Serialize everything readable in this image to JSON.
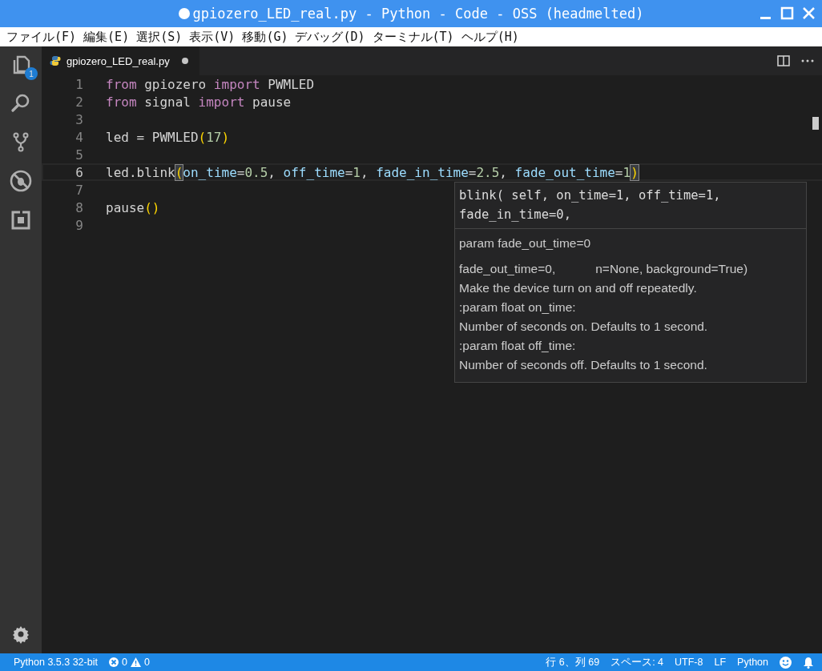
{
  "window": {
    "title": "gpiozero_LED_real.py - Python - Code - OSS (headmelted)",
    "dirty": true
  },
  "menu": [
    "ファイル(F)",
    "編集(E)",
    "選択(S)",
    "表示(V)",
    "移動(G)",
    "デバッグ(D)",
    "ターミナル(T)",
    "ヘルプ(H)"
  ],
  "activity_bar": {
    "items": [
      {
        "kind": "files",
        "selected": false,
        "badge": "1"
      },
      {
        "kind": "search",
        "selected": false
      },
      {
        "kind": "git",
        "selected": false
      },
      {
        "kind": "debug",
        "selected": false
      },
      {
        "kind": "extensions",
        "selected": false
      }
    ]
  },
  "tabs": [
    {
      "label": "gpiozero_LED_real.py",
      "selected": true,
      "dirty": true
    }
  ],
  "editor": {
    "lines": [
      {
        "number": "1",
        "current": false,
        "tokens": [
          {
            "text": "from",
            "kind": "keyword"
          },
          {
            "text": " gpiozero ",
            "kind": "plain"
          },
          {
            "text": "import",
            "kind": "keyword"
          },
          {
            "text": " PWMLED",
            "kind": "plain"
          }
        ]
      },
      {
        "number": "2",
        "current": false,
        "tokens": [
          {
            "text": "from",
            "kind": "keyword"
          },
          {
            "text": " signal ",
            "kind": "plain"
          },
          {
            "text": "import",
            "kind": "keyword"
          },
          {
            "text": " pause",
            "kind": "plain"
          }
        ]
      },
      {
        "number": "3",
        "current": false
      },
      {
        "number": "4",
        "current": false,
        "tokens": [
          {
            "text": "led = PWMLED",
            "kind": "plain"
          },
          {
            "text": "(",
            "kind": "paren"
          },
          {
            "text": "17",
            "kind": "number"
          },
          {
            "text": ")",
            "kind": "paren"
          }
        ]
      },
      {
        "number": "5",
        "current": false
      },
      {
        "number": "6",
        "current": true,
        "tokens": [
          {
            "text": "led.blink",
            "kind": "plain"
          },
          {
            "text": "(",
            "kind": "bracket"
          },
          {
            "text": "on_time",
            "kind": "param"
          },
          {
            "text": "=",
            "kind": "plain"
          },
          {
            "text": "0.5",
            "kind": "number"
          },
          {
            "text": ", ",
            "kind": "plain"
          },
          {
            "text": "off_time",
            "kind": "param"
          },
          {
            "text": "=",
            "kind": "plain"
          },
          {
            "text": "1",
            "kind": "number"
          },
          {
            "text": ", ",
            "kind": "plain"
          },
          {
            "text": "fade_in_time",
            "kind": "param"
          },
          {
            "text": "=",
            "kind": "plain"
          },
          {
            "text": "2.5",
            "kind": "number"
          },
          {
            "text": ", ",
            "kind": "plain"
          },
          {
            "text": "fade_out_time",
            "kind": "param"
          },
          {
            "text": "=",
            "kind": "plain"
          },
          {
            "text": "1",
            "kind": "number"
          },
          {
            "text": ")",
            "kind": "bracket"
          }
        ]
      },
      {
        "number": "7",
        "current": false
      },
      {
        "number": "8",
        "current": false,
        "tokens": [
          {
            "text": "pause",
            "kind": "plain"
          },
          {
            "text": "()",
            "kind": "paren"
          }
        ]
      },
      {
        "number": "9",
        "current": false
      }
    ],
    "hover": {
      "signature": [
        "blink( self, on_time=1, off_time=1,",
        "fade_in_time=0,"
      ],
      "doc": [
        {
          "texts": [
            "param fade_out_time=0"
          ]
        },
        {
          "texts": [
            "fade_out_time=0,",
            "n=None, background=True)"
          ]
        },
        {
          "texts": [
            "Make the device turn on and off repeatedly."
          ]
        },
        {
          "texts": [
            ":param float on_time:"
          ]
        },
        {
          "texts": [
            "Number of seconds on. Defaults to 1 second."
          ]
        },
        {
          "texts": [
            ":param float off_time:"
          ]
        },
        {
          "texts": [
            "Number of seconds off. Defaults to 1 second."
          ]
        }
      ]
    }
  },
  "status_bar": {
    "interpreter": "Python 3.5.3 32-bit",
    "errors": "0",
    "warnings": "0",
    "position": "行 6、列 69",
    "indent": "スペース: 4",
    "encoding": "UTF-8",
    "eol": "LF",
    "language": "Python"
  }
}
